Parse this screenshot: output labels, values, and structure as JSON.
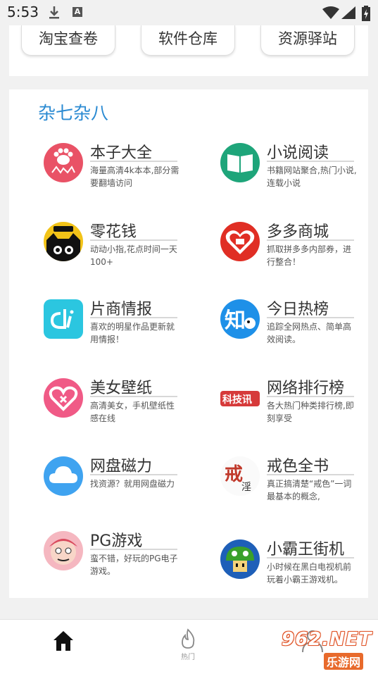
{
  "status_bar": {
    "time": "5:53"
  },
  "top_links": [
    "淘宝查卷",
    "软件仓库",
    "资源驿站"
  ],
  "section": {
    "title": "杂七杂八",
    "items": [
      {
        "title": "本子大全",
        "desc": "海量高清4k本本,部分需要翻墙访问",
        "icon": "paw-icon",
        "color": "#e95266"
      },
      {
        "title": "小说阅读",
        "desc": "书籍网站聚合,热门小说,连载小说",
        "icon": "book-icon",
        "color": "#1ea57a"
      },
      {
        "title": "零花钱",
        "desc": "动动小指,花点时间一天100+",
        "icon": "reward-cat-icon",
        "color": "#f2c318"
      },
      {
        "title": "多多商城",
        "desc": "抓取拼多多内部券，进行整合！",
        "icon": "heart-shop-icon",
        "color": "#e02e24"
      },
      {
        "title": "片商情报",
        "desc": "喜欢的明星作品更新就用情报！",
        "icon": "di-logo-icon",
        "color": "#2bc6e0"
      },
      {
        "title": "今日热榜",
        "desc": "追踪全网热点、简单高效阅读。",
        "icon": "zhi-icon",
        "color": "#1e90e8"
      },
      {
        "title": "美女壁纸",
        "desc": "高清美女，手机壁纸性感在线",
        "icon": "heart-icon",
        "color": "#f05a86"
      },
      {
        "title": "网络排行榜",
        "desc": "各大热门种类排行榜,即刻享受",
        "icon": "kejixun-icon",
        "color": "#d63a3a"
      },
      {
        "title": "网盘磁力",
        "desc": "找资源？就用网盘磁力",
        "icon": "cloud-icon",
        "color": "#3fa3f0"
      },
      {
        "title": "戒色全书",
        "desc": "真正搞清楚“戒色”一词最基本的概念,",
        "icon": "calligraphy-icon",
        "color": "#c0392b"
      },
      {
        "title": "PG游戏",
        "desc": "蛮不错，好玩的PG电子游戏。",
        "icon": "cartoon-face-icon",
        "color": "#e07a8a"
      },
      {
        "title": "小霸王街机",
        "desc": "小时候在黑白电视机前玩着小霸王游戏机。",
        "icon": "mushroom-icon",
        "color": "#3a9a2a"
      }
    ]
  },
  "bottom_nav": [
    {
      "label": "",
      "icon": "home-icon"
    },
    {
      "label": "热门",
      "icon": "flame-icon"
    },
    {
      "label": "",
      "icon": "user-icon"
    }
  ],
  "watermark": {
    "text": "962.NET",
    "sub": "乐游网"
  }
}
